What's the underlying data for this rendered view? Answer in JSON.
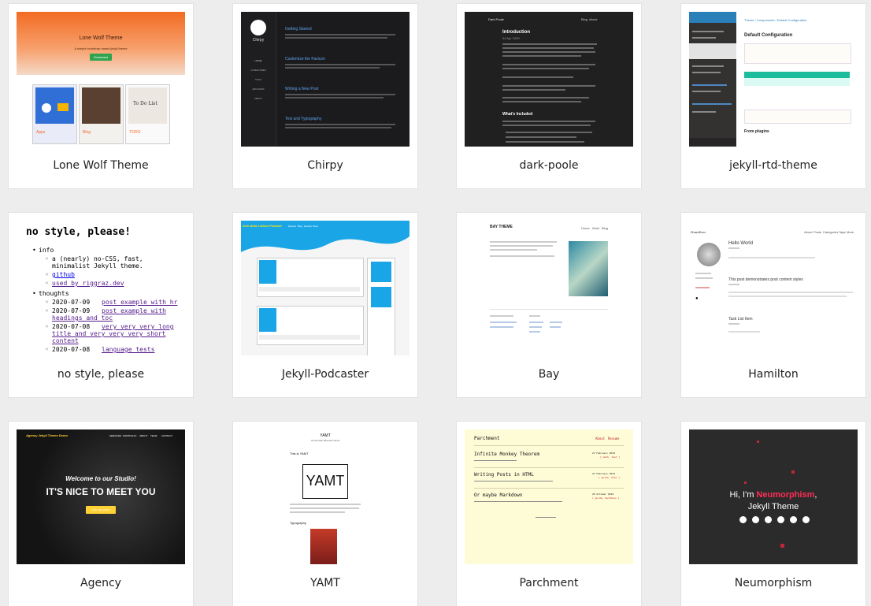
{
  "cards": [
    {
      "title": "Lone Wolf Theme",
      "thumb": {
        "hero_title": "Lone Wolf Theme",
        "hero_sub": "A simple bootstrap based jekyll theme",
        "button": "Download",
        "tiles": [
          {
            "label": "Apps"
          },
          {
            "label": "Blog"
          },
          {
            "label": "TODO"
          }
        ]
      }
    },
    {
      "title": "Chirpy",
      "thumb": {
        "site": "Chirpy",
        "nav": [
          "HOME",
          "CATEGORIES",
          "TAGS",
          "ARCHIVES",
          "ABOUT"
        ],
        "posts": [
          "Getting Started",
          "Customize the Favicon",
          "Writing a New Post",
          "Text and Typography"
        ]
      }
    },
    {
      "title": "dark-poole",
      "thumb": {
        "site": "Dark Poole",
        "nav": [
          "Blog",
          "About"
        ],
        "heading": "Introduction",
        "date": "04 Apr 2009",
        "whats": "What's Included"
      }
    },
    {
      "title": "jekyll-rtd-theme",
      "thumb": {
        "heading": "Default Configuration",
        "section": "From plugins",
        "breadcrumb": "Theme / Components / Default Configuration"
      }
    },
    {
      "title": "no style, please",
      "thumb": {
        "heading": "no style, please!",
        "info": "info",
        "desc": "a (nearly) no-CSS, fast, minimalist Jekyll theme.",
        "links": [
          "github",
          "used by riggraz.dev"
        ],
        "thoughts": "thoughts",
        "entries": [
          {
            "date": "2020-07-09",
            "text": "post example with hr"
          },
          {
            "date": "2020-07-09",
            "text": "post example with headings and toc"
          },
          {
            "date": "2020-07-08",
            "text": "very very very long title and very very very short content"
          },
          {
            "date": "2020-07-08",
            "text": "language tests"
          }
        ]
      }
    },
    {
      "title": "Jekyll-Podcaster",
      "thumb": {
        "site": "Arte della Lettura Podcast",
        "nav": [
          "Episodi",
          "Blog",
          "Review",
          "Shop"
        ]
      }
    },
    {
      "title": "Bay",
      "thumb": {
        "site": "BAY THEME",
        "nav": [
          "Home",
          "Work",
          "Blog"
        ]
      }
    },
    {
      "title": "Hamilton",
      "thumb": {
        "site": "Hamilton",
        "nav": [
          "About",
          "Posts",
          "Categories",
          "Tags",
          "More"
        ],
        "posts": [
          "Hello World",
          "This post demonstrates post content styles",
          "Task List Item"
        ]
      }
    },
    {
      "title": "Agency",
      "thumb": {
        "site": "Agency Jekyll Theme Demo",
        "nav": [
          "SERVICES",
          "PORTFOLIO",
          "ABOUT",
          "TEAM",
          "CONTACT"
        ],
        "welcome": "Welcome to our Studio!",
        "headline": "IT'S NICE TO MEET YOU",
        "button": "TELL ME MORE"
      }
    },
    {
      "title": "YAMT",
      "thumb": {
        "site": "YAMT",
        "sub": "Yet Another Minimal Theme",
        "post": "This is YAMT",
        "logo": "YAMT",
        "section": "Typography"
      }
    },
    {
      "title": "Parchment",
      "thumb": {
        "site": "Parchment",
        "nav": [
          "About",
          "Resume"
        ],
        "posts": [
          {
            "title": "Infinite Monkey Theorem",
            "date": "27 February 2019",
            "tags": "[ math, test ]"
          },
          {
            "title": "Writing Posts in HTML",
            "date": "27 February 2019",
            "tags": "[ guide, html ]"
          },
          {
            "title": "Or maybe Markdown",
            "date": "26 October 2019",
            "tags": "[ guide, markdown ]"
          }
        ]
      }
    },
    {
      "title": "Neumorphism",
      "thumb": {
        "greeting": "Hi, I'm",
        "name": "Neumorphism",
        "tail": "Jekyll Theme",
        "accent": "#e0245e"
      }
    }
  ]
}
